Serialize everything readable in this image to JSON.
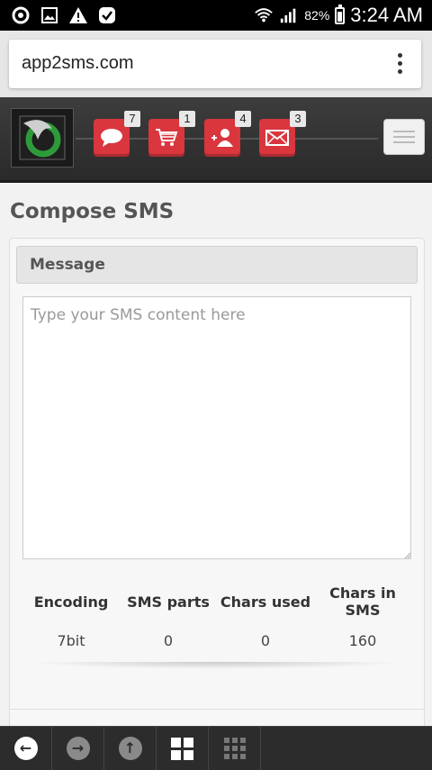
{
  "statusbar": {
    "left_icons": [
      "sync-icon",
      "image-icon",
      "warning-icon",
      "check-icon"
    ],
    "battery_percent": "82%",
    "battery_level": 0.82,
    "time": "3:24 AM"
  },
  "browser": {
    "url": "app2sms.com"
  },
  "navbar": {
    "buttons": [
      {
        "icon": "chat-icon",
        "badge": "7"
      },
      {
        "icon": "cart-icon",
        "badge": "1"
      },
      {
        "icon": "add-contact-icon",
        "badge": "4"
      },
      {
        "icon": "mail-icon",
        "badge": "3"
      }
    ],
    "colors": {
      "button": "#d9363e",
      "bar": "#333333",
      "logo_ring": "#2e9b3a"
    }
  },
  "main": {
    "title": "Compose SMS",
    "panel_heading": "Message",
    "message_placeholder": "Type your SMS content here",
    "message_value": "",
    "stats": {
      "headers": [
        "Encoding",
        "SMS parts",
        "Chars used",
        "Chars in SMS"
      ],
      "values": [
        "7bit",
        "0",
        "0",
        "160"
      ]
    }
  },
  "bottombar": {
    "buttons": [
      "back-icon",
      "forward-icon",
      "up-icon",
      "tiles-icon",
      "apps-grid-icon"
    ]
  }
}
